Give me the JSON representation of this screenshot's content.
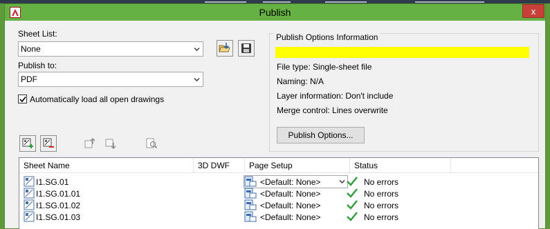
{
  "window": {
    "title": "Publish",
    "close_glyph": "x",
    "icons": {
      "app": "autocad-icon",
      "close": "close-icon"
    }
  },
  "sheet_list": {
    "label": "Sheet List:",
    "value": "None",
    "load_icon": "load-sheet-list-icon",
    "save_icon": "save-sheet-list-icon"
  },
  "publish_to": {
    "label": "Publish to:",
    "value": "PDF"
  },
  "auto_load": {
    "label": "Automatically load all open drawings",
    "checked": true
  },
  "options_info": {
    "title": "Publish Options Information",
    "highlight_color": "#ffff00",
    "lines": [
      "File type: Single-sheet file",
      "Naming: N/A",
      "Layer information: Don't include",
      "Merge control: Lines overwrite"
    ],
    "button_label": "Publish Options..."
  },
  "toolbar": {
    "icons": [
      "add-sheets-icon",
      "remove-sheets-icon",
      "move-up-icon",
      "move-down-icon",
      "preview-icon"
    ]
  },
  "table": {
    "columns": [
      "Sheet Name",
      "3D DWF",
      "Page Setup",
      "Status"
    ],
    "rows": [
      {
        "sheet": "I1.SG.01",
        "dwf": "",
        "page_setup": "<Default: None>",
        "status": "No errors",
        "combo_open": true
      },
      {
        "sheet": "I1.SG.01.01",
        "dwf": "",
        "page_setup": "<Default: None>",
        "status": "No errors",
        "combo_open": false
      },
      {
        "sheet": "I1.SG.01.02",
        "dwf": "",
        "page_setup": "<Default: None>",
        "status": "No errors",
        "combo_open": false
      },
      {
        "sheet": "I1.SG.01.03",
        "dwf": "",
        "page_setup": "<Default: None>",
        "status": "No errors",
        "combo_open": false
      }
    ],
    "status_color": "#2e9a3a"
  }
}
